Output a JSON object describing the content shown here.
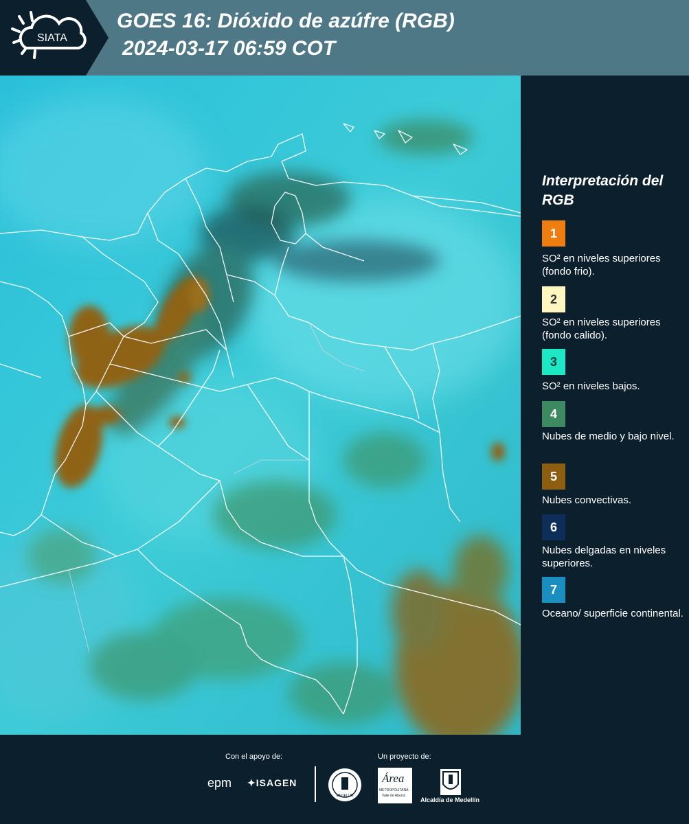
{
  "header": {
    "logo_text": "SIATA",
    "title_line1": "GOES 16: Dióxido de azúfre (RGB)",
    "title_line2": "2024-03-17 06:59 COT"
  },
  "legend": {
    "title": "Interpretación del RGB",
    "items": [
      {
        "number": "1",
        "color": "#f07d10",
        "number_color": "#ffffff",
        "label": "SO² en niveles superiores (fondo frio)."
      },
      {
        "number": "2",
        "color": "#fff6c0",
        "number_color": "#333333",
        "label": "SO² en niveles superiores (fondo calido)."
      },
      {
        "number": "3",
        "color": "#1de8c6",
        "number_color": "#1f3a3a",
        "label": "SO² en niveles bajos."
      },
      {
        "number": "4",
        "color": "#3d8a62",
        "number_color": "#ffffff",
        "label": "Nubes de medio y bajo nivel."
      },
      {
        "number": "5",
        "color": "#8e5e10",
        "number_color": "#ffffff",
        "label": "Nubes convectivas."
      },
      {
        "number": "6",
        "color": "#0e2e5a",
        "number_color": "#ffffff",
        "label": "Nubes delgadas en niveles superiores."
      },
      {
        "number": "7",
        "color": "#1b8ec0",
        "number_color": "#ffffff",
        "label": "Oceano/ superficie continental."
      }
    ]
  },
  "footer": {
    "support_label": "Con el apoyo de:",
    "project_label": "Un proyecto de:",
    "sponsor_epm": "epm",
    "sponsor_isagen": "ISAGEN",
    "partner_area_name": "Área",
    "partner_area_sub1": "METROPOLITANA",
    "partner_area_sub2": "Valle de Aburrá",
    "partner_alcaldia": "Alcaldía de Medellín",
    "partner_seal_text": "MEDELLÍN"
  },
  "colors": {
    "header_bg": "#4f7886",
    "page_bg": "#0c1f2d",
    "map_base": "#2ec3d6",
    "border_lines": "#ffffff"
  }
}
